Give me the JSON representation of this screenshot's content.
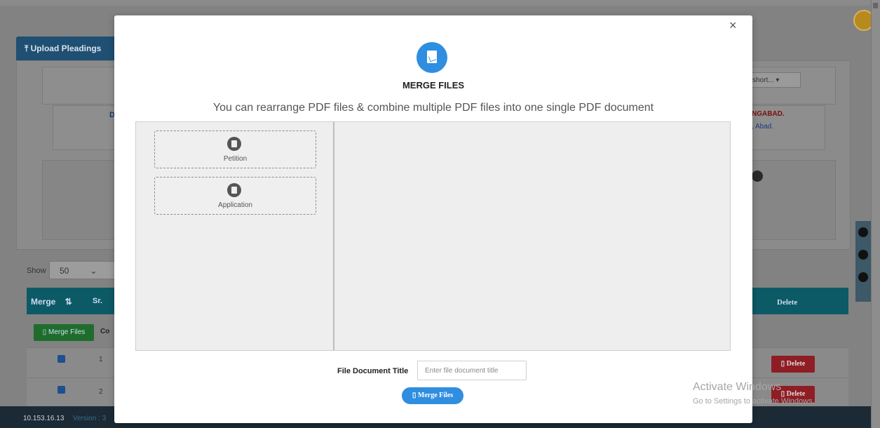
{
  "background": {
    "upload_tab": "Upload Pleadings",
    "select_short": "short...",
    "org_name_fragment": "NGABAD.",
    "org_addr_fragment": ", Abad.",
    "letter_fragment": "D",
    "show_label": "Show",
    "show_value": "50",
    "table": {
      "col_merge": "Merge",
      "col_sr": "Sr.",
      "col_delete": "Delete",
      "merge_files_button": "Merge Files",
      "con_fragment": "Co",
      "rows": [
        {
          "num": "1",
          "checked": true,
          "delete_label": "Delete"
        },
        {
          "num": "2",
          "checked": true,
          "delete_label": "Delete"
        }
      ]
    },
    "footer": {
      "ip": "10.153.16.13",
      "version": "Version : 3"
    },
    "watermark": {
      "line1": "Activate Windows",
      "line2": "Go to Settings to activate Windows."
    }
  },
  "modal": {
    "close": "×",
    "icon": "pdf-file-icon",
    "title": "MERGE FILES",
    "subtitle": "You can rearrange PDF files & combine multiple PDF files into one single PDF document",
    "files": [
      {
        "label": "Petition",
        "icon": "pdf-icon"
      },
      {
        "label": "Application",
        "icon": "pdf-icon"
      }
    ],
    "doc_title_label": "File Document Title",
    "doc_title_placeholder": "Enter file document title",
    "doc_title_value": "",
    "merge_button": "Merge Files"
  },
  "colors": {
    "accent": "#2f8ee0",
    "table_header": "#0d5a67",
    "delete_red": "#8f1d24",
    "merge_green": "#1f6d2c"
  }
}
